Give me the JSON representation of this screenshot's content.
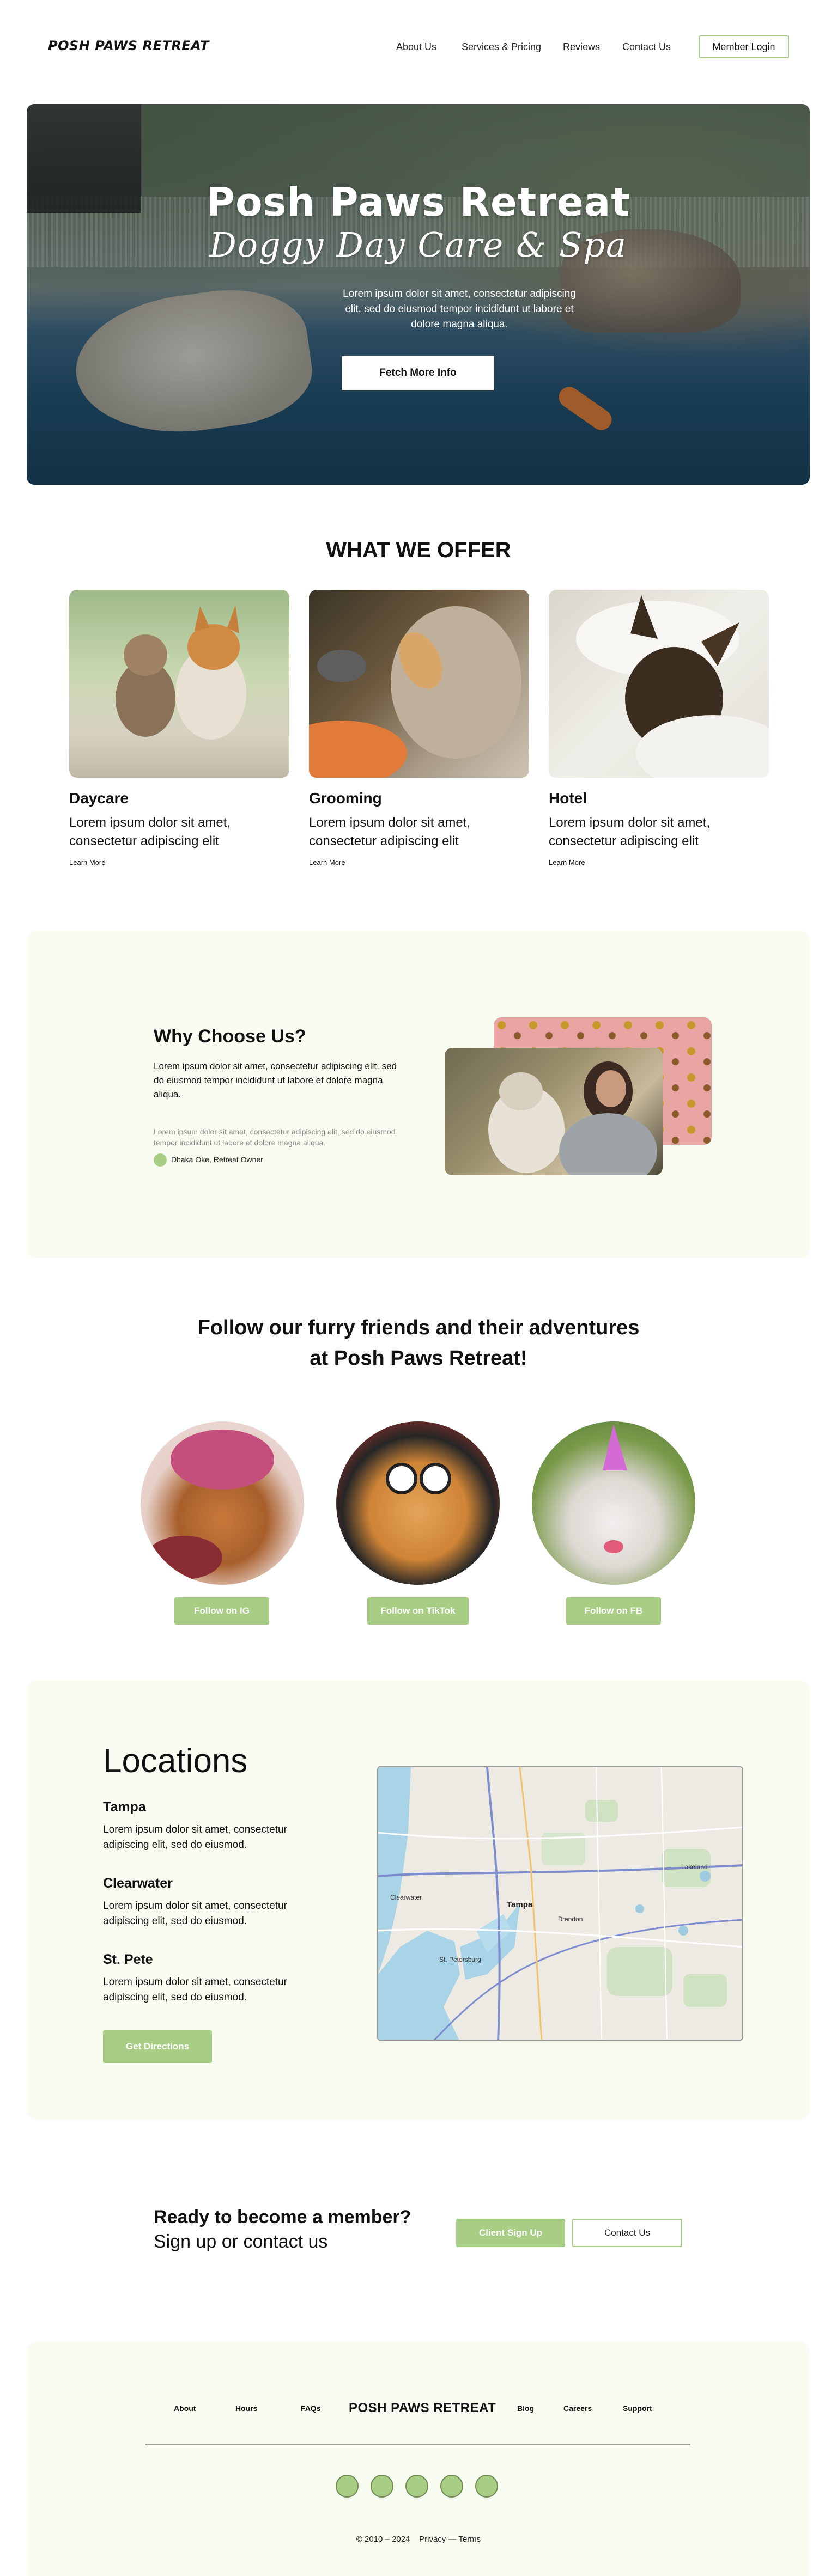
{
  "header": {
    "logo": "POSH PAWS RETREAT",
    "nav": [
      "About Us",
      "Services & Pricing",
      "Reviews",
      "Contact Us"
    ],
    "member_login": "Member Login"
  },
  "hero": {
    "title": "Posh Paws Retreat",
    "subtitle": "Doggy Day Care & Spa",
    "text": "Lorem ipsum dolor sit amet, consectetur adipiscing elit, sed do eiusmod tempor incididunt ut labore et dolore magna aliqua.",
    "button": "Fetch More Info"
  },
  "offer": {
    "title": "WHAT WE OFFER",
    "cards": [
      {
        "title": "Daycare",
        "text": "Lorem ipsum dolor sit amet, consectetur adipiscing elit",
        "link": "Learn More"
      },
      {
        "title": "Grooming",
        "text": "Lorem ipsum dolor sit amet, consectetur adipiscing elit",
        "link": "Learn More"
      },
      {
        "title": "Hotel",
        "text": "Lorem ipsum dolor sit amet, consectetur adipiscing elit",
        "link": "Learn More"
      }
    ]
  },
  "why": {
    "title": "Why Choose Us?",
    "text": "Lorem ipsum dolor sit amet, consectetur adipiscing elit, sed do eiusmod tempor incididunt ut labore et dolore magna aliqua.",
    "quote": "Lorem ipsum dolor sit amet, consectetur adipiscing elit, sed do eiusmod tempor incididunt ut labore et dolore magna aliqua.",
    "author": "Dhaka Oke, Retreat Owner"
  },
  "follow": {
    "title_line1": "Follow our furry friends and their adventures",
    "title_line2": "at Posh Paws Retreat!",
    "buttons": [
      "Follow on IG",
      "Follow on TikTok",
      "Follow on FB"
    ]
  },
  "locations": {
    "title": "Locations",
    "items": [
      {
        "name": "Tampa",
        "text": "Lorem ipsum dolor sit amet, consectetur adipiscing elit, sed do eiusmod."
      },
      {
        "name": "Clearwater",
        "text": "Lorem ipsum dolor sit amet, consectetur adipiscing elit, sed do eiusmod."
      },
      {
        "name": "St. Pete",
        "text": "Lorem ipsum dolor sit amet, consectetur adipiscing elit, sed do eiusmod."
      }
    ],
    "button": "Get Directions",
    "map_labels": [
      "Lakeland",
      "Clearwater",
      "Tampa",
      "St. Petersburg",
      "Brandon"
    ]
  },
  "cta": {
    "title": "Ready to become a member?",
    "subtitle": "Sign up or contact us",
    "signup": "Client Sign Up",
    "contact": "Contact Us"
  },
  "footer": {
    "links_left": [
      "About",
      "Hours",
      "FAQs"
    ],
    "logo": "POSH PAWS RETREAT",
    "links_right": [
      "Blog",
      "Careers",
      "Support"
    ],
    "copyright": "© 2010 – 2024",
    "legal": "Privacy — Terms"
  },
  "colors": {
    "accent": "#a8cd84",
    "panel_bg": "#f9fdf1"
  }
}
